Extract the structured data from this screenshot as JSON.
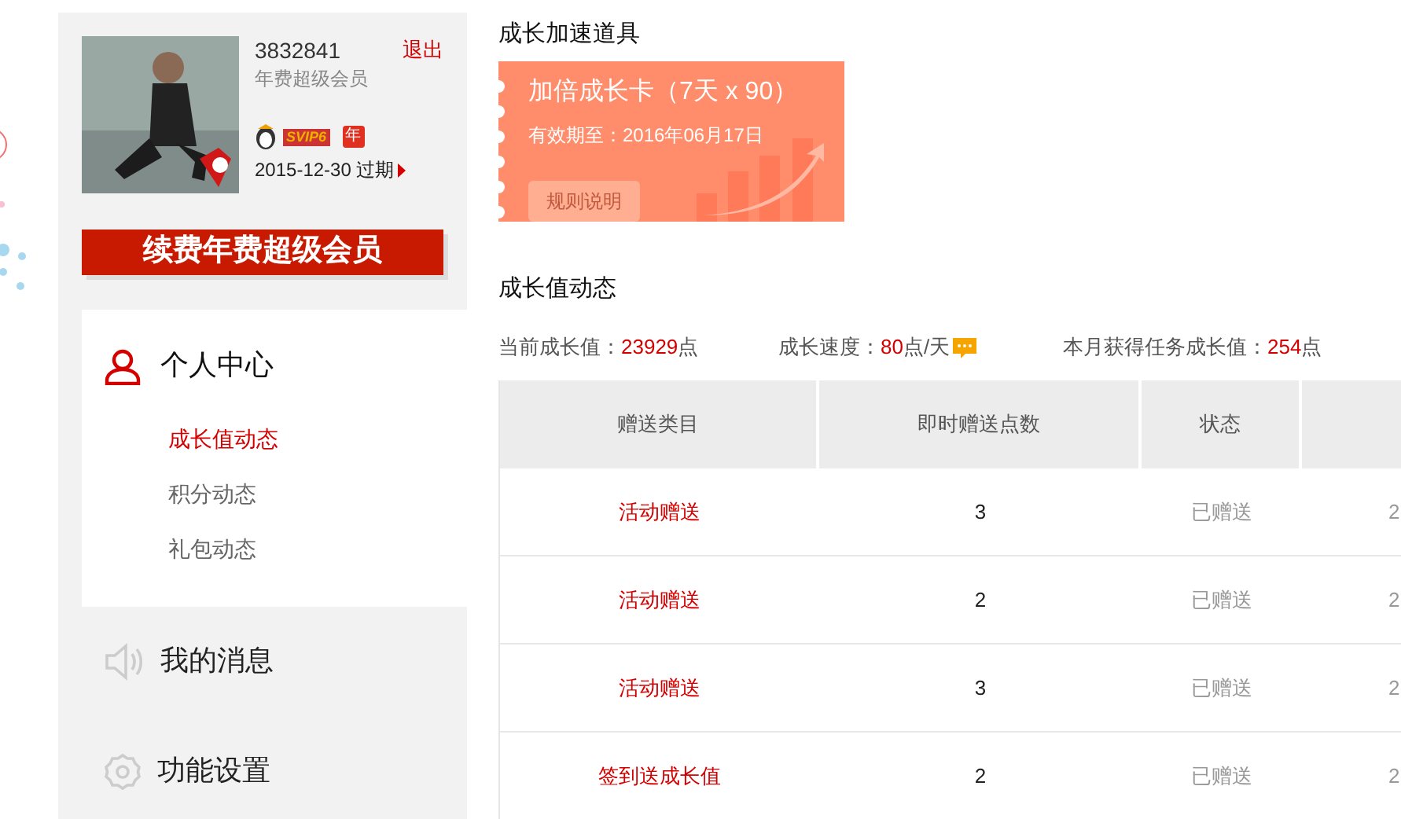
{
  "user": {
    "id": "3832841",
    "logout": "退出",
    "membership": "年费超级会员",
    "vip_badge": "SVIP6",
    "year_badge": "年",
    "expiry": "2015-12-30",
    "expiry_label": "过期"
  },
  "renew_button": "续费年费超级会员",
  "sidebar": {
    "sections": [
      {
        "kind": "person",
        "label": "个人中心",
        "expanded": true,
        "children": [
          {
            "label": "成长值动态",
            "selected": true
          },
          {
            "label": "积分动态",
            "selected": false
          },
          {
            "label": "礼包动态",
            "selected": false
          }
        ]
      },
      {
        "kind": "speaker",
        "label": "我的消息",
        "expanded": false
      },
      {
        "kind": "gear",
        "label": "功能设置",
        "expanded": false
      }
    ]
  },
  "boost": {
    "title": "成长加速道具",
    "card": {
      "name": "加倍成长卡（7天 x 90）",
      "validity": "有效期至：2016年06月17日",
      "rules_button": "规则说明"
    }
  },
  "growth": {
    "title": "成长值动态",
    "stats": [
      {
        "label": "当前成长值：",
        "value": "23929",
        "unit": "点"
      },
      {
        "label": "成长速度：",
        "value": "80",
        "unit": "点/天",
        "tip": true
      },
      {
        "label": "本月获得任务成长值：",
        "value": "254",
        "unit": "点"
      }
    ]
  },
  "table": {
    "columns": [
      "赠送类目",
      "即时赠送点数",
      "状态"
    ],
    "rows": [
      {
        "category": "活动赠送",
        "points": "3",
        "status": "已赠送",
        "column_4": "2"
      },
      {
        "category": "活动赠送",
        "points": "2",
        "status": "已赠送",
        "column_4": "2"
      },
      {
        "category": "活动赠送",
        "points": "3",
        "status": "已赠送",
        "column_4": "2"
      },
      {
        "category": "签到送成长值",
        "points": "2",
        "status": "已赠送",
        "column_4": "2"
      }
    ]
  }
}
